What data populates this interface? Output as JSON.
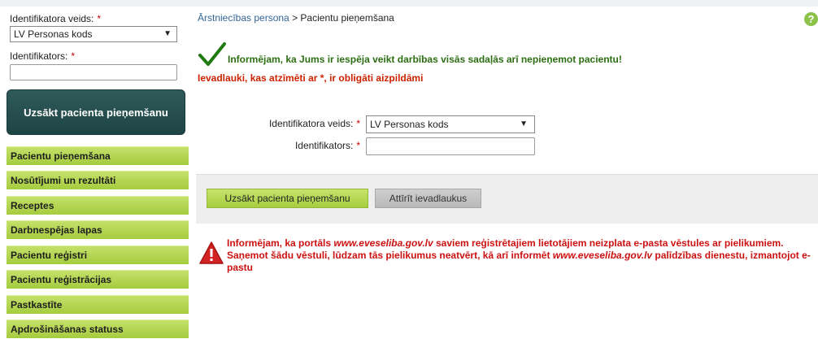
{
  "sidebar": {
    "id_type_label": "Identifikatora veids:",
    "id_type_value": "LV Personas kods",
    "id_label": "Identifikators:",
    "required_mark": "*",
    "start_button": "Uzsākt pacienta pieņemšanu",
    "nav": [
      "Pacientu pieņemšana",
      "Nosūtījumi un rezultāti",
      "Receptes",
      "Darbnespējas lapas",
      "Pacientu reģistri",
      "Pacientu reģistrācijas",
      "Pastkastīte",
      "Apdrošināšanas statuss"
    ]
  },
  "breadcrumb": {
    "parent": "Ārstniecības persona",
    "separator": " > ",
    "current": "Pacientu pieņemšana"
  },
  "help_icon": "?",
  "info_message": "Informējam, ka Jums ir iespēja veikt darbības visās sadaļās arī nepieņemot pacientu!",
  "required_note": "Ievadlauki, kas atzīmēti ar *, ir obligāti aizpildāmi",
  "form": {
    "id_type_label": "Identifikatora veids:",
    "id_type_value": "LV Personas kods",
    "id_label": "Identifikators:",
    "required_mark": "*"
  },
  "buttons": {
    "start": "Uzsākt pacienta pieņemšanu",
    "clear": "Attīrīt ievadlaukus"
  },
  "warning": {
    "part1": "Informējam, ka portāls ",
    "site1": "www.eveseliba.gov.lv",
    "part2": " saviem reģistrētajiem lietotājiem neizplata e-pasta vēstules ar pielikumiem. Saņemot šādu vēstuli, lūdzam tās pielikumus neatvērt, kā arī informēt ",
    "site2": "www.eveseliba.gov.lv",
    "part3": " palīdzības dienestu, izmantojot e-pastu"
  },
  "colors": {
    "nav_green": "#b5d74f",
    "start_button_dark": "#264c4c",
    "info_green": "#2c6e12",
    "alert_red": "#cc1111"
  },
  "icons": {
    "success": "checkmark-icon",
    "warning": "warning-triangle-icon",
    "help": "help-icon"
  }
}
